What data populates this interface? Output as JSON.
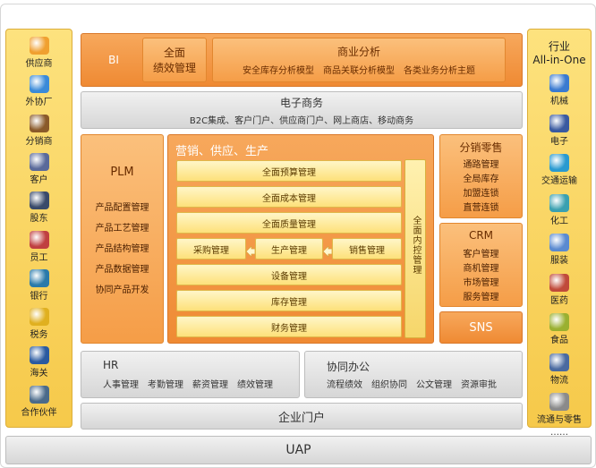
{
  "left_column": {
    "items": [
      {
        "label": "供应商",
        "icon": "supplier-icon",
        "color": "#f0a030"
      },
      {
        "label": "外协厂",
        "icon": "outsourcing-icon",
        "color": "#3a8ad8"
      },
      {
        "label": "分销商",
        "icon": "distributor-icon",
        "color": "#8a5a2a"
      },
      {
        "label": "客户",
        "icon": "customer-icon",
        "color": "#5a6a9a"
      },
      {
        "label": "股东",
        "icon": "shareholder-icon",
        "color": "#3a4a6a"
      },
      {
        "label": "员工",
        "icon": "employee-icon",
        "color": "#c04040"
      },
      {
        "label": "银行",
        "icon": "bank-icon",
        "color": "#2a7aaa"
      },
      {
        "label": "税务",
        "icon": "tax-icon",
        "color": "#e0b020"
      },
      {
        "label": "海关",
        "icon": "customs-icon",
        "color": "#2a5aa0"
      },
      {
        "label": "合作伙伴",
        "icon": "partner-icon",
        "color": "#4a6a8a"
      }
    ]
  },
  "right_column": {
    "title_line1": "行业",
    "title_line2": "All-in-One",
    "items": [
      {
        "label": "机械",
        "icon": "machinery-icon",
        "color": "#3a7ad0"
      },
      {
        "label": "电子",
        "icon": "electronics-icon",
        "color": "#3a5aa0"
      },
      {
        "label": "交通运输",
        "icon": "transport-icon",
        "color": "#2a9ad0"
      },
      {
        "label": "化工",
        "icon": "chemical-icon",
        "color": "#3aa0b0"
      },
      {
        "label": "服装",
        "icon": "apparel-icon",
        "color": "#5a8ad0"
      },
      {
        "label": "医药",
        "icon": "medicine-icon",
        "color": "#c04a3a"
      },
      {
        "label": "食品",
        "icon": "food-icon",
        "color": "#9ab030"
      },
      {
        "label": "物流",
        "icon": "logistics-icon",
        "color": "#4a6aa0"
      },
      {
        "label": "流通与零售",
        "icon": "retail-icon",
        "color": "#8a8a8a"
      }
    ],
    "more": "……"
  },
  "bi": {
    "label": "BI",
    "performance_line1": "全面",
    "performance_line2": "绩效管理",
    "analysis_title": "商业分析",
    "analysis_items": "安全库存分析模型　商品关联分析模型　各类业务分析主题"
  },
  "ecommerce": {
    "title": "电子商务",
    "items": "B2C集成、客户门户、供应商门户、网上商店、移动商务"
  },
  "plm": {
    "title": "PLM",
    "items": [
      "产品配置管理",
      "产品工艺管理",
      "产品结构管理",
      "产品数据管理",
      "协同产品开发"
    ]
  },
  "scm": {
    "title": "营销、供应、生产",
    "rows": [
      "全面预算管理",
      "全面成本管理",
      "全面质量管理",
      "设备管理",
      "库存管理",
      "财务管理"
    ],
    "flow": {
      "purchase": "采购管理",
      "production": "生产管理",
      "sales": "销售管理"
    },
    "internal_control": "全面内控管理"
  },
  "retail": {
    "title": "分销零售",
    "items": [
      "通路管理",
      "全局库存",
      "加盟连锁",
      "直营连锁"
    ]
  },
  "crm": {
    "title": "CRM",
    "items": [
      "客户管理",
      "商机管理",
      "市场管理",
      "服务管理"
    ]
  },
  "sns": {
    "label": "SNS"
  },
  "hr": {
    "title": "HR",
    "items": "人事管理　考勤管理　薪资管理　绩效管理"
  },
  "oa": {
    "title": "协同办公",
    "items": "流程绩效　组织协同　公文管理　资源审批"
  },
  "portal": {
    "label": "企业门户"
  },
  "uap": {
    "label": "UAP"
  }
}
